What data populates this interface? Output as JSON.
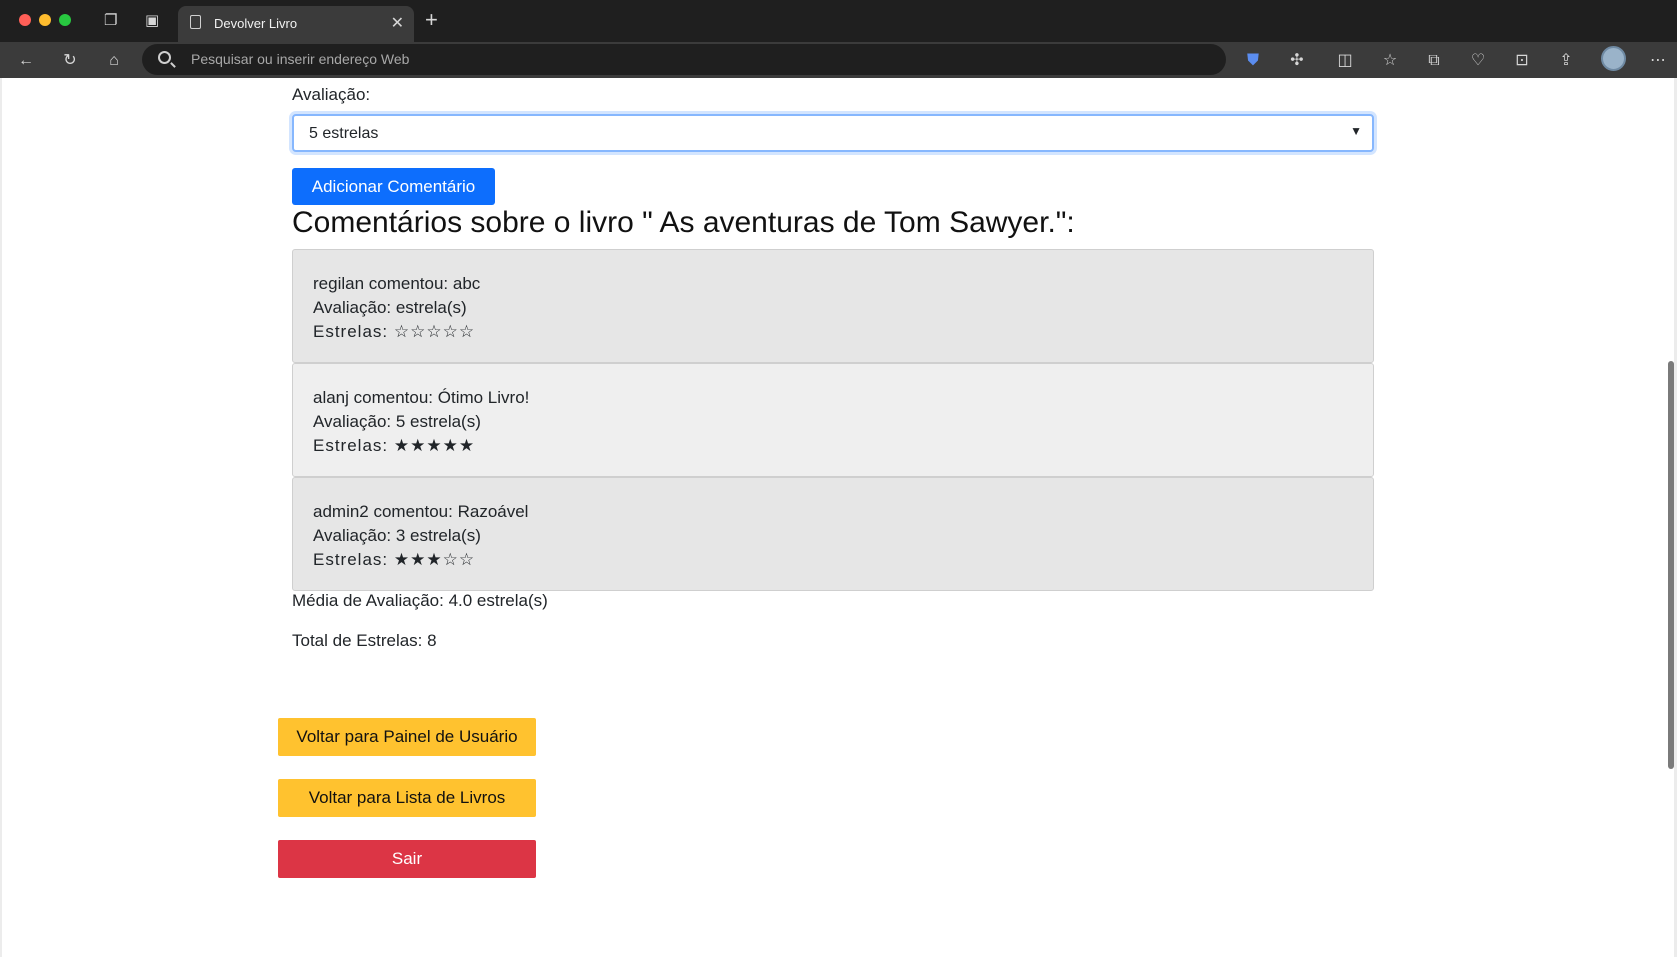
{
  "browser": {
    "tab_title": "Devolver Livro",
    "address_placeholder": "Pesquisar ou inserir endereço Web"
  },
  "page": {
    "rating_label": "Avaliação:",
    "rating_select": {
      "selected": "5 estrelas"
    },
    "add_comment_button": "Adicionar Comentário",
    "comments_heading": "Comentários sobre o livro \" As aventuras de Tom Sawyer.\":",
    "comments": [
      {
        "line1": "regilan comentou: abc",
        "line2": "Avaliação: estrela(s)",
        "line3": "Estrelas: ☆☆☆☆☆"
      },
      {
        "line1": "alanj comentou: Ótimo Livro!",
        "line2": "Avaliação: 5 estrela(s)",
        "line3": "Estrelas: ★★★★★"
      },
      {
        "line1": "admin2 comentou: Razoável",
        "line2": "Avaliação: 3 estrela(s)",
        "line3": "Estrelas: ★★★☆☆"
      }
    ],
    "average_rating": "Média de Avaliação: 4.0 estrela(s)",
    "total_stars": "Total de Estrelas: 8",
    "buttons": {
      "back_user_panel": "Voltar para Painel de Usuário",
      "back_book_list": "Voltar para Lista de Livros",
      "logout": "Sair"
    }
  },
  "colors": {
    "primary": "#0d6efd",
    "warning": "#ffc22f",
    "danger": "#dc3545"
  }
}
